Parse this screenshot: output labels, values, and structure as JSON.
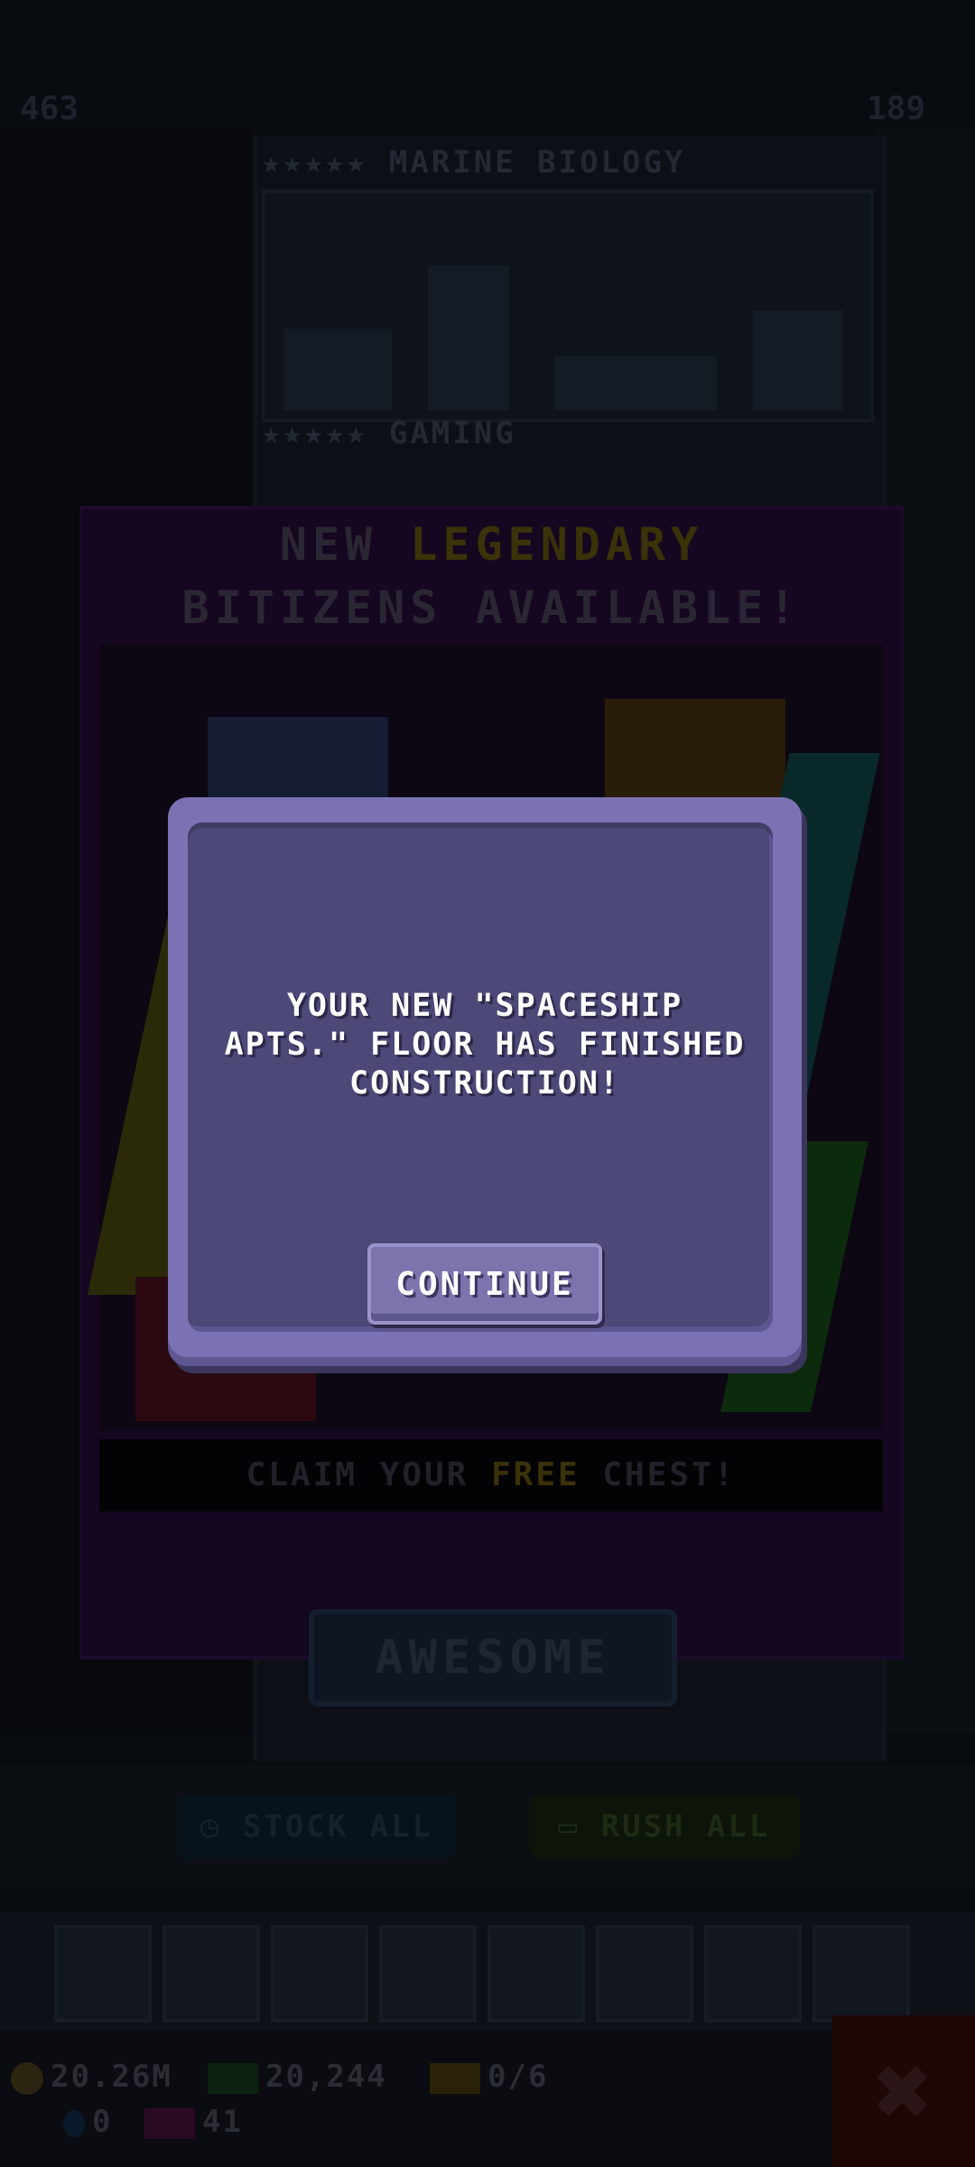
{
  "hud": {
    "left_count": "463",
    "right_count": "189"
  },
  "floors": [
    {
      "name": "MARINE BIOLOGY",
      "stars": "★★★★★"
    },
    {
      "name": "GAMING",
      "stars": "★★★★★"
    }
  ],
  "promo": {
    "title_prefix": "NEW ",
    "title_highlight": "LEGENDARY",
    "title_line2": "BITIZENS AVAILABLE!",
    "claim_prefix": "CLAIM YOUR ",
    "claim_highlight": "FREE",
    "claim_suffix": " CHEST!",
    "awesome_label": "AWESOME"
  },
  "actions": {
    "stock_all": "STOCK ALL",
    "rush_all": "RUSH ALL"
  },
  "status": {
    "coins": "20.26M",
    "bux": "20,244",
    "tickets": "0/6",
    "gems": "0",
    "level": "41"
  },
  "dialog": {
    "message_line1": "YOUR NEW \"SPACESHIP",
    "message_line2": "APTS.\" FLOOR HAS FINISHED",
    "message_line3": "CONSTRUCTION!",
    "continue_label": "CONTINUE"
  },
  "colors": {
    "dialog_frame": "#7b72b4",
    "dialog_inner": "#4c4877",
    "button": "#7b74ad",
    "legendary": "#e8c400"
  }
}
